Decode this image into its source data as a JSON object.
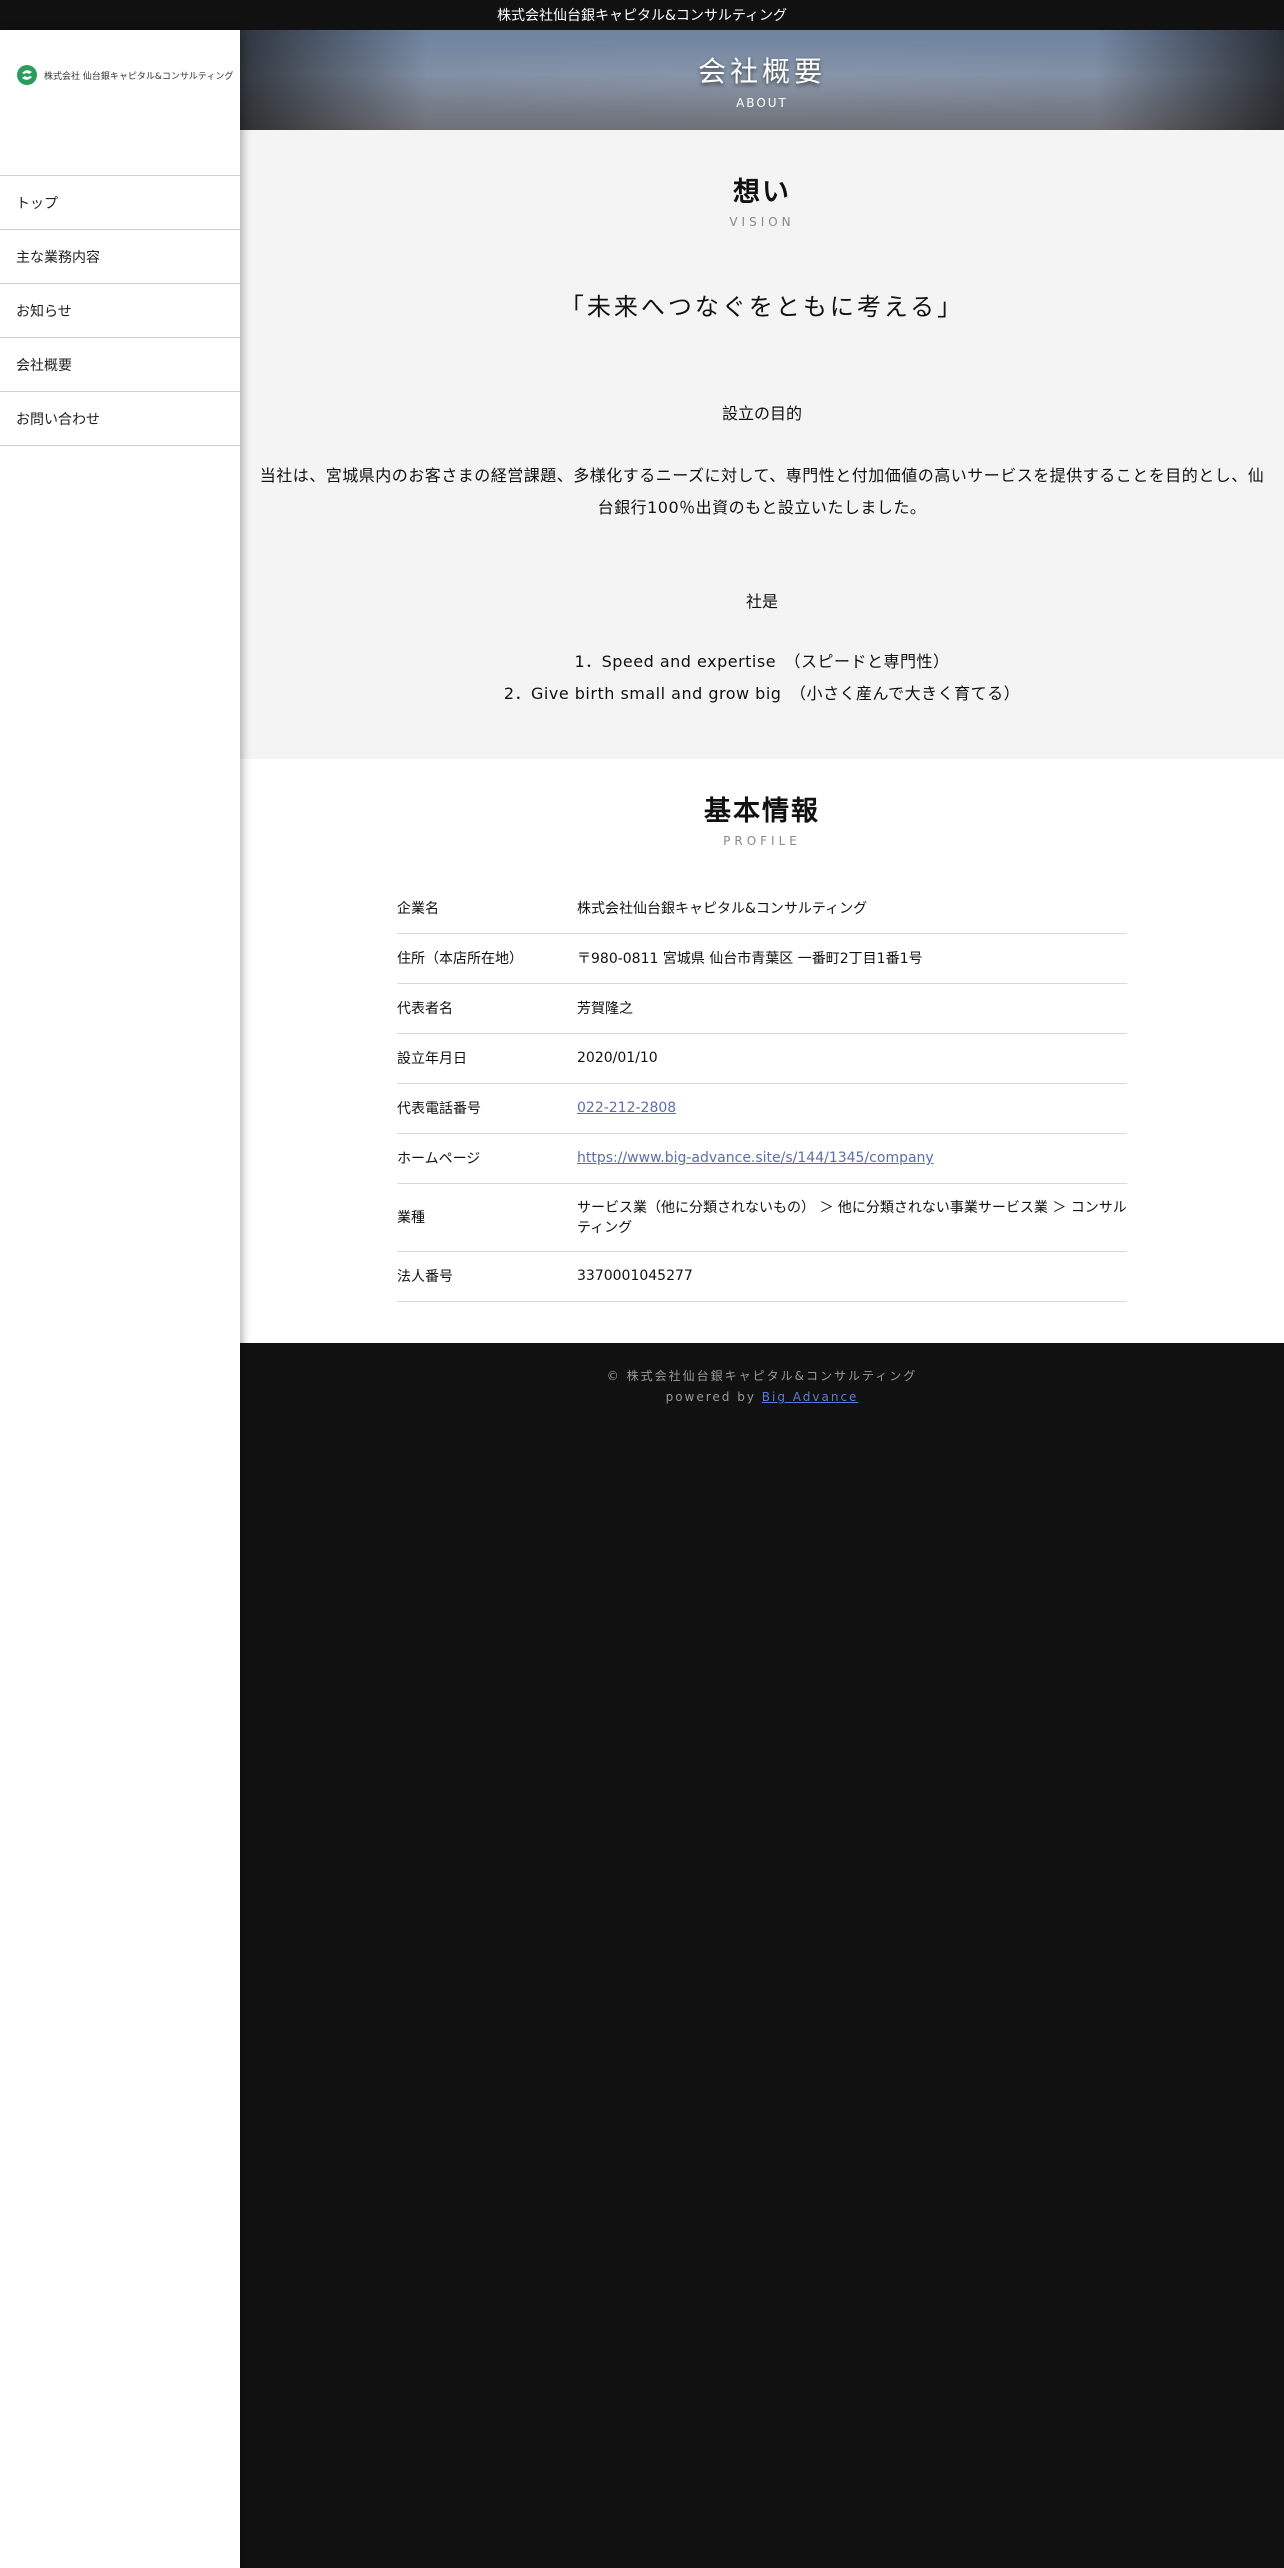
{
  "topbar": {
    "title": "株式会社仙台銀キャピタル&コンサルティング"
  },
  "sidebar": {
    "logo_text": "株式会社 仙台銀キャピタル&コンサルティング",
    "items": [
      {
        "label": "トップ"
      },
      {
        "label": "主な業務内容"
      },
      {
        "label": "お知らせ"
      },
      {
        "label": "会社概要"
      },
      {
        "label": "お問い合わせ"
      }
    ]
  },
  "hero": {
    "title": "会社概要",
    "subtitle": "ABOUT"
  },
  "vision": {
    "title": "想い",
    "subtitle": "VISION",
    "motto": "「未来へつなぐをともに考える」",
    "purpose_heading": "設立の目的",
    "purpose_line1": "当社は、宮城県内のお客さまの経営課題、多様化するニーズに対して、専門性と付加価値の高いサービスを提供することを目的とし、仙",
    "purpose_line2": "台銀行100％出資のもと設立いたしました。",
    "credo_heading": "社是",
    "credo_1": "1．Speed and expertise　（スピードと専門性）",
    "credo_2": "2．Give birth small and grow big　（小さく産んで大きく育てる）"
  },
  "profile": {
    "title": "基本情報",
    "subtitle": "PROFILE",
    "rows": [
      {
        "key": "企業名",
        "value": "株式会社仙台銀キャピタル&コンサルティング"
      },
      {
        "key": "住所（本店所在地）",
        "value": "〒980-0811 宮城県 仙台市青葉区 一番町2丁目1番1号"
      },
      {
        "key": "代表者名",
        "value": "芳賀隆之"
      },
      {
        "key": "設立年月日",
        "value": "2020/01/10"
      },
      {
        "key": "代表電話番号",
        "value": "022-212-2808"
      },
      {
        "key": "ホームページ",
        "value": "https://www.big-advance.site/s/144/1345/company"
      },
      {
        "key": "業種",
        "value": "サービス業（他に分類されないもの） ＞ 他に分類されない事業サービス業 ＞ コンサルティング"
      },
      {
        "key": "法人番号",
        "value": "3370001045277"
      }
    ]
  },
  "footer": {
    "copyright": "© 株式会社仙台銀キャピタル&コンサルティング",
    "powered_prefix": "powered by ",
    "powered_link": "Big Advance"
  },
  "colors": {
    "brand_green": "#2a9d5c",
    "link": "#5b6fa8",
    "footer_bg": "#111111"
  }
}
